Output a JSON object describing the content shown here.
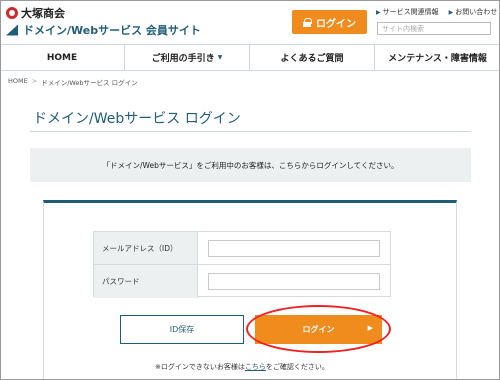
{
  "header": {
    "brand_name": "大塚商会",
    "site_title": "ドメイン/Webサービス 会員サイト",
    "login_button": "ログイン",
    "top_links": [
      {
        "label": "サービス関連情報"
      },
      {
        "label": "お問い合わせ"
      }
    ],
    "search_placeholder": "サイト内検索"
  },
  "nav": {
    "items": [
      {
        "label": "HOME",
        "has_caret": false
      },
      {
        "label": "ご利用の手引き",
        "has_caret": true
      },
      {
        "label": "よくあるご質問",
        "has_caret": false
      },
      {
        "label": "メンテナンス・障害情報",
        "has_caret": false
      }
    ]
  },
  "breadcrumb": {
    "home": "HOME",
    "separator": ">",
    "current": "ドメイン/Webサービス ログイン"
  },
  "main": {
    "title": "ドメイン/Webサービス ログイン",
    "notice": "「ドメイン/Webサービス」をご利用中のお客様は、こちらからログインしてください。",
    "form": {
      "email_label": "メールアドレス（ID）",
      "email_value": "",
      "password_label": "パスワード",
      "password_value": ""
    },
    "id_save_button": "ID保存",
    "login_button": "ログイン",
    "help_prefix": "※ログインできないお客様は",
    "help_link": "こちら",
    "help_suffix": "をご確認ください。"
  },
  "colors": {
    "accent": "#1f5d79",
    "button_orange": "#f08c1e",
    "highlight": "#e22222"
  }
}
